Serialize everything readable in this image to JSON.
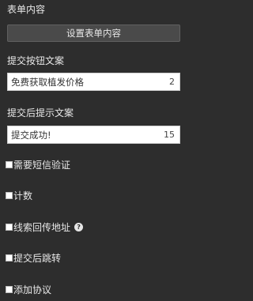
{
  "form_content": {
    "title": "表单内容",
    "button_label": "设置表单内容"
  },
  "submit_text": {
    "title": "提交按钮文案",
    "value": "免费获取植发价格",
    "count": "2"
  },
  "after_submit": {
    "title": "提交后提示文案",
    "value": "提交成功!",
    "count": "15"
  },
  "options": {
    "sms": "需要短信验证",
    "counter": "计数",
    "lead_return": "线索回传地址",
    "help_glyph": "?",
    "redirect": "提交后跳转",
    "agreement": "添加协议"
  },
  "colors": {
    "background": "#2d2d2d",
    "button_bg": "#4a4a4a",
    "input_bg": "#ffffff",
    "text": "#e8e8e8"
  }
}
